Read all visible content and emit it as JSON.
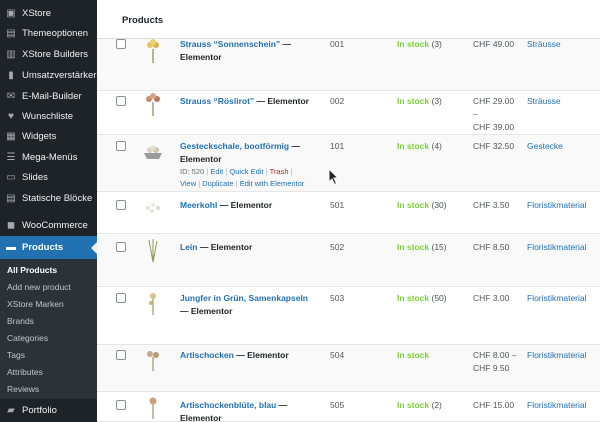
{
  "sidebar": {
    "items": [
      {
        "label": "XStore",
        "icon": "xstore-icon"
      },
      {
        "label": "Themeoptionen",
        "icon": "theme-options-icon"
      },
      {
        "label": "XStore Builders",
        "icon": "builders-icon"
      },
      {
        "label": "Umsatzverstärker",
        "icon": "sales-booster-icon"
      },
      {
        "label": "E-Mail-Builder",
        "icon": "email-icon"
      },
      {
        "label": "Wunschliste",
        "icon": "heart-icon"
      },
      {
        "label": "Widgets",
        "icon": "widgets-icon"
      },
      {
        "label": "Mega-Menüs",
        "icon": "mega-menu-icon"
      },
      {
        "label": "Slides",
        "icon": "slides-icon"
      },
      {
        "label": "Statische Blöcke",
        "icon": "static-blocks-icon"
      },
      {
        "label": "WooCommerce",
        "icon": "woocommerce-icon"
      },
      {
        "label": "Products",
        "icon": "products-icon"
      }
    ],
    "submenu": [
      "All Products",
      "Add new product",
      "XStore Marken",
      "Brands",
      "Categories",
      "Tags",
      "Attributes",
      "Reviews"
    ],
    "portfolio": {
      "label": "Portfolio",
      "icon": "portfolio-icon"
    }
  },
  "header": {
    "title": "Products"
  },
  "products": [
    {
      "name": "Strauss “Sonnenschein”",
      "suffix": "— Elementor",
      "sku": "001",
      "stock": "In stock",
      "qty": "(3)",
      "price1": "CHF 49.00",
      "price2": "",
      "price3": "",
      "category": "Sträusse"
    },
    {
      "name": "Strauss “Röslirot”",
      "suffix": "— Elementor",
      "sku": "002",
      "stock": "In stock",
      "qty": "(3)",
      "price1": "CHF 29.00",
      "price2": "–",
      "price3": "CHF 39.00",
      "category": "Sträusse"
    },
    {
      "name": "Gesteckschale, bootförmig",
      "suffix": "— Elementor",
      "sku": "101",
      "stock": "In stock",
      "qty": "(4)",
      "price1": "CHF 32.50",
      "price2": "",
      "price3": "",
      "category": "Gestecke",
      "actions": {
        "id": "ID: 520",
        "edit": "Edit",
        "quick_edit": "Quick Edit",
        "trash": "Trash",
        "view": "View",
        "duplicate": "Duplicate",
        "edit_elementor": "Edit with Elementor"
      }
    },
    {
      "name": "Meerkohl",
      "suffix": "— Elementor",
      "sku": "501",
      "stock": "In stock",
      "qty": "(30)",
      "price1": "CHF 3.50",
      "price2": "",
      "price3": "",
      "category": "Floristikmaterial"
    },
    {
      "name": "Lein",
      "suffix": "— Elementor",
      "sku": "502",
      "stock": "In stock",
      "qty": "(15)",
      "price1": "CHF 8.50",
      "price2": "",
      "price3": "",
      "category": "Floristikmaterial"
    },
    {
      "name": "Jungfer in Grün, Samenkapseln",
      "suffix": "— Elementor",
      "sku": "503",
      "stock": "In stock",
      "qty": "(50)",
      "price1": "CHF 3.00",
      "price2": "",
      "price3": "",
      "category": "Floristikmaterial"
    },
    {
      "name": "Artischocken",
      "suffix": "— Elementor",
      "sku": "504",
      "stock": "In stock",
      "qty": "",
      "price1": "CHF 8.00 –",
      "price2": "CHF 9.50",
      "price3": "",
      "category": "Floristikmaterial"
    },
    {
      "name": "Artischockenblüte, blau",
      "suffix": "— Elementor",
      "sku": "505",
      "stock": "In stock",
      "qty": "(2)",
      "price1": "CHF 15.00",
      "price2": "",
      "price3": "",
      "category": "Floristikmaterial"
    }
  ],
  "colors": {
    "sidebar_bg": "#1d2327",
    "accent": "#2271b1",
    "in_stock": "#7ad03a"
  }
}
